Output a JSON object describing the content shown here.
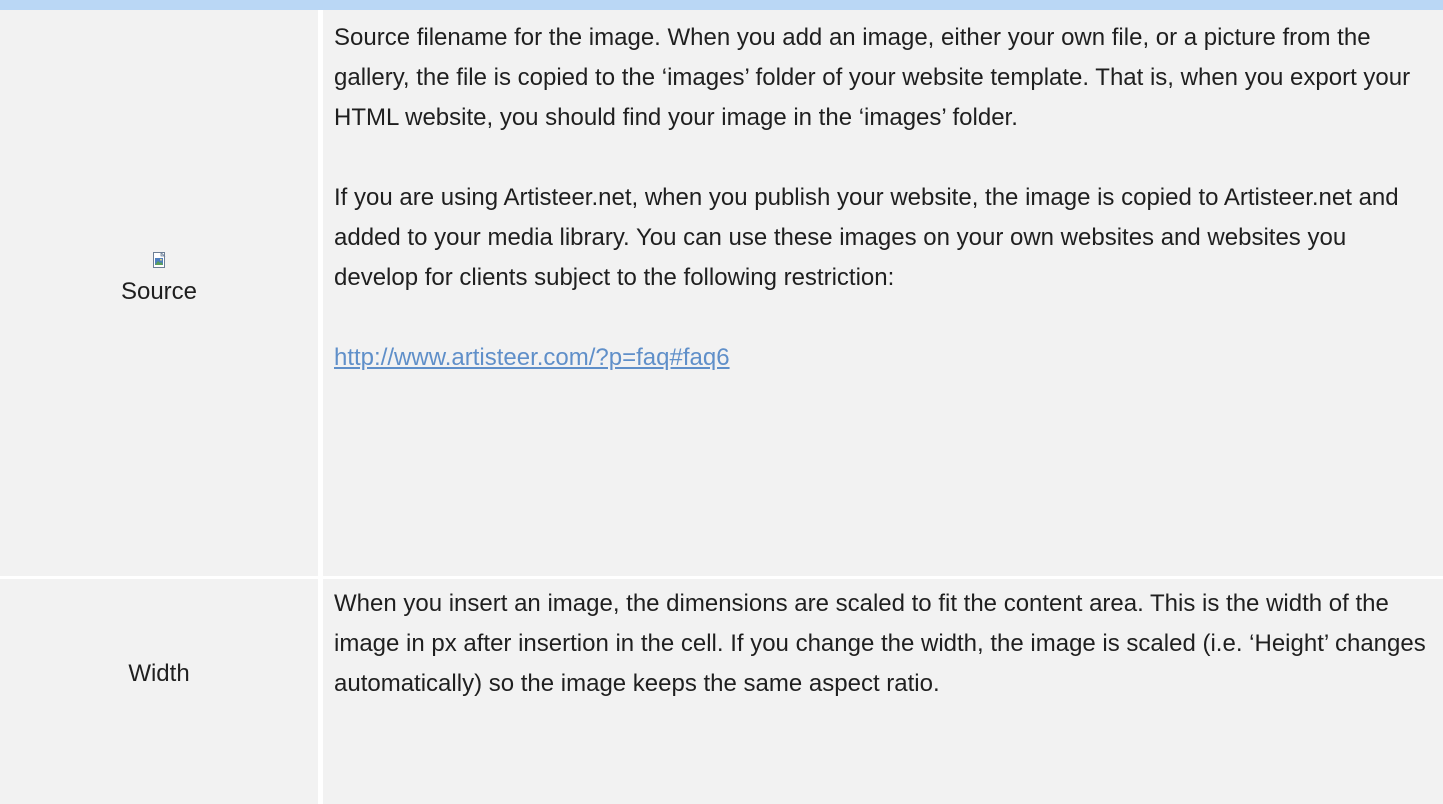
{
  "rows": [
    {
      "label": "Source",
      "icon": "image-file-icon",
      "paragraphs": [
        "Source filename for the image.   When you add an image, either your own file, or a picture from the gallery, the file is copied to the ‘images’ folder of your website template.  That is, when you export your HTML website, you should find your image in the ‘images’ folder.",
        "If you are using Artisteer.net, when you publish your website, the image is copied to Artisteer.net and added to your media library.  You can use these images on your own websites and websites you develop for clients subject to the following restriction:"
      ],
      "link": "http://www.artisteer.com/?p=faq#faq6"
    },
    {
      "label": "Width",
      "paragraphs": [
        "When you insert an image, the dimensions are scaled to fit the content area.  This is the width of the image in px after insertion in the cell.  If you change the width, the image is scaled (i.e. ‘Height’ changes automatically) so the image keeps the same aspect ratio."
      ]
    }
  ],
  "colors": {
    "header_bar": "#bad7f5",
    "cell_background": "#f2f2f2",
    "link": "#5f8fc9"
  }
}
